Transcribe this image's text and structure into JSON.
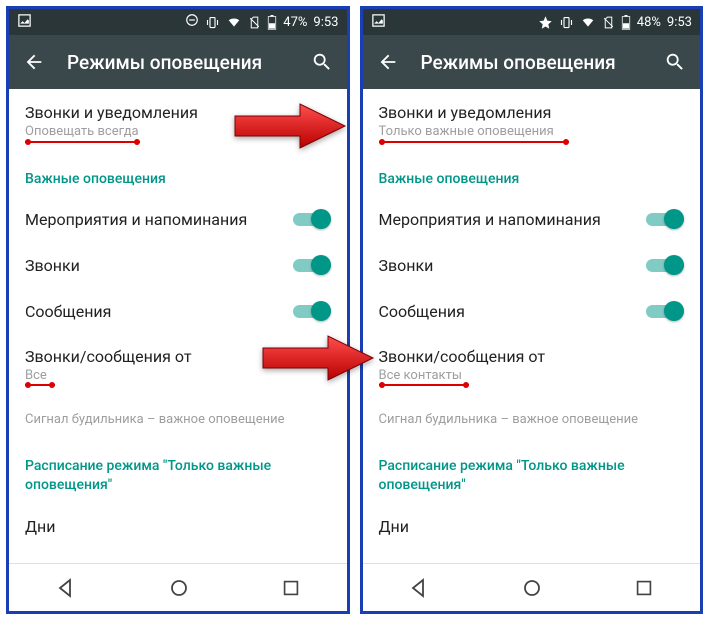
{
  "left": {
    "status": {
      "battery": "47%",
      "time": "9:53"
    },
    "header": {
      "title": "Режимы оповещения"
    },
    "calls_notif": {
      "title": "Звонки и уведомления",
      "sub": "Оповещать всегда"
    },
    "section_priority": "Важные оповещения",
    "events": "Мероприятия и напоминания",
    "calls": "Звонки",
    "messages": "Сообщения",
    "from": {
      "title": "Звонки/сообщения от",
      "sub": "Все"
    },
    "alarm_note": "Сигнал будильника – важное оповещение",
    "schedule_header": "Расписание режима \"Только важные оповещения\"",
    "days": "Дни"
  },
  "right": {
    "status": {
      "battery": "48%",
      "time": "9:53"
    },
    "header": {
      "title": "Режимы оповещения"
    },
    "calls_notif": {
      "title": "Звонки и уведомления",
      "sub": "Только важные оповещения"
    },
    "section_priority": "Важные оповещения",
    "events": "Мероприятия и напоминания",
    "calls": "Звонки",
    "messages": "Сообщения",
    "from": {
      "title": "Звонки/сообщения от",
      "sub": "Все контакты"
    },
    "alarm_note": "Сигнал будильника – важное оповещение",
    "schedule_header": "Расписание режима \"Только важные оповещения\"",
    "days": "Дни"
  }
}
